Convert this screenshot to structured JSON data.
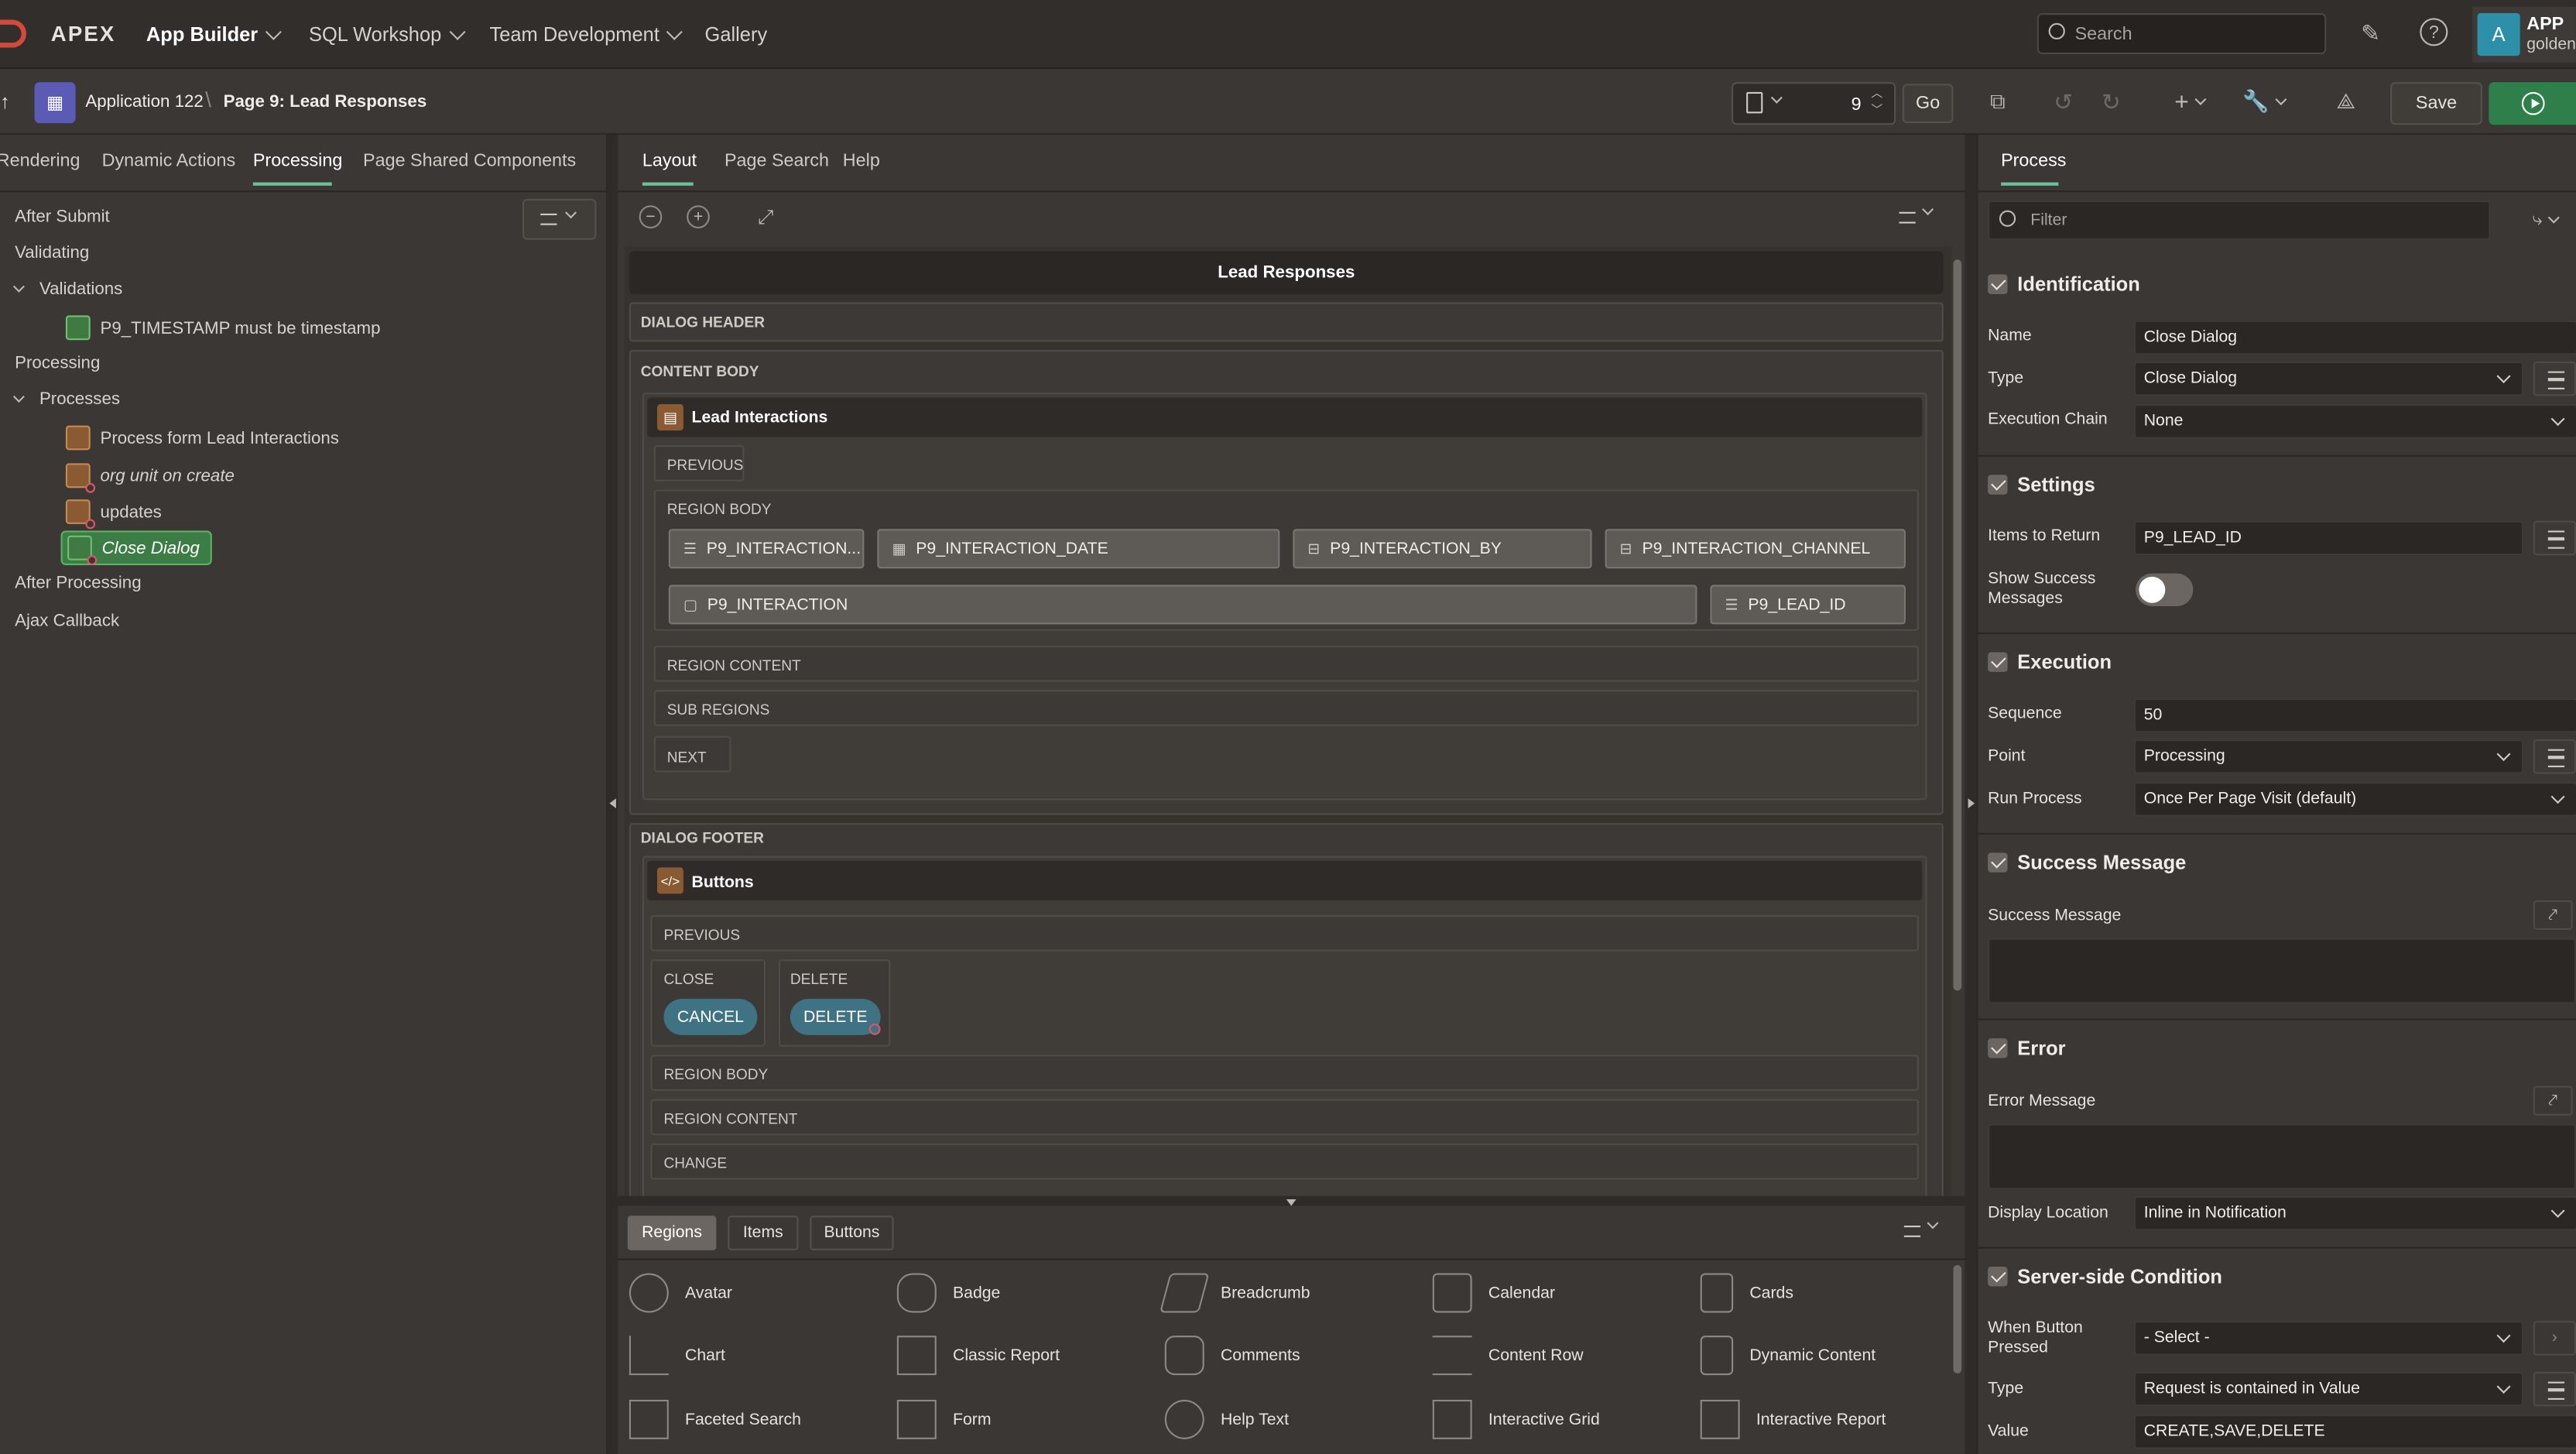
{
  "nav": {
    "brand": "APEX",
    "app_builder": "App Builder",
    "sql_workshop": "SQL Workshop",
    "team_dev": "Team Development",
    "gallery": "Gallery",
    "search_placeholder": "Search",
    "avatar_letter": "A",
    "user_line1": "APP",
    "user_line2": "golden"
  },
  "toolbar": {
    "app_name": "Application 122",
    "page_name": "Page 9: Lead Responses",
    "page_number": "9",
    "go_label": "Go",
    "save_label": "Save"
  },
  "left": {
    "tabs": [
      "Rendering",
      "Dynamic Actions",
      "Processing",
      "Page Shared Components"
    ],
    "active_tab": "Processing",
    "tree": {
      "after_submit": "After Submit",
      "validating": "Validating",
      "validations": "Validations",
      "validation_item": "P9_TIMESTAMP must be timestamp",
      "processing": "Processing",
      "processes": "Processes",
      "process_1": "Process form Lead Interactions",
      "process_2": "org unit on create",
      "process_3": "updates",
      "process_4": "Close Dialog",
      "after_processing": "After Processing",
      "ajax_callback": "Ajax Callback"
    }
  },
  "center": {
    "tabs": [
      "Layout",
      "Page Search",
      "Help"
    ],
    "page_title": "Lead Responses",
    "dialog_header": "DIALOG HEADER",
    "content_body": "CONTENT BODY",
    "region1_name": "Lead Interactions",
    "previous": "PREVIOUS",
    "region_body": "REGION BODY",
    "items": [
      "P9_INTERACTION...",
      "P9_INTERACTION_DATE",
      "P9_INTERACTION_BY",
      "P9_INTERACTION_CHANNEL",
      "P9_INTERACTION",
      "P9_LEAD_ID"
    ],
    "region_content": "REGION CONTENT",
    "sub_regions": "SUB REGIONS",
    "next": "NEXT",
    "dialog_footer": "DIALOG FOOTER",
    "region2_name": "Buttons",
    "close_pos": "CLOSE",
    "delete_pos": "DELETE",
    "cancel_btn": "CANCEL",
    "delete_btn": "DELETE",
    "change": "CHANGE",
    "gallery_tabs": [
      "Regions",
      "Items",
      "Buttons"
    ],
    "gallery": [
      "Avatar",
      "Badge",
      "Breadcrumb",
      "Calendar",
      "Cards",
      "Chart",
      "Classic Report",
      "Comments",
      "Content Row",
      "Dynamic Content",
      "Faceted Search",
      "Form",
      "Help Text",
      "Interactive Grid",
      "Interactive Report"
    ]
  },
  "right": {
    "tab": "Process",
    "filter_placeholder": "Filter",
    "identification": "Identification",
    "name_label": "Name",
    "name_value": "Close Dialog",
    "type_label": "Type",
    "type_value": "Close Dialog",
    "exec_chain_label": "Execution Chain",
    "exec_chain_value": "None",
    "settings": "Settings",
    "items_return_label": "Items to Return",
    "items_return_value": "P9_LEAD_ID",
    "show_success_label": "Show Success Messages",
    "execution": "Execution",
    "sequence_label": "Sequence",
    "sequence_value": "50",
    "point_label": "Point",
    "point_value": "Processing",
    "run_process_label": "Run Process",
    "run_process_value": "Once Per Page Visit (default)",
    "success_message": "Success Message",
    "success_message_label": "Success Message",
    "error": "Error",
    "error_message_label": "Error Message",
    "display_location_label": "Display Location",
    "display_location_value": "Inline in Notification",
    "server_condition": "Server-side Condition",
    "when_button_label": "When Button Pressed",
    "when_button_value": "- Select -",
    "cond_type_label": "Type",
    "cond_type_value": "Request is contained in Value",
    "value_label": "Value",
    "value_value": "CREATE,SAVE,DELETE"
  },
  "colors": {
    "accent": "#3f7384",
    "run_green": "#2f7f4b",
    "avatar": "#2e8fa8"
  }
}
